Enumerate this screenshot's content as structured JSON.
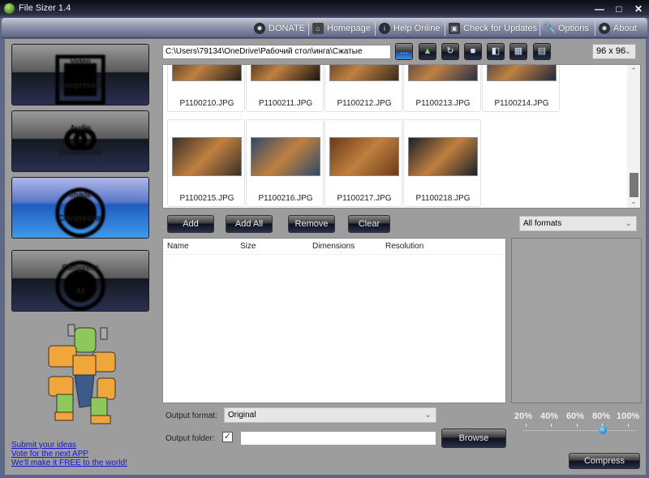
{
  "window": {
    "title": "File Sizer 1.4",
    "controls": [
      "minimize",
      "maximize",
      "close"
    ]
  },
  "toolbar": {
    "items": [
      {
        "label": "DONATE",
        "icon": "donate-icon"
      },
      {
        "label": "Homepage",
        "icon": "home-icon"
      },
      {
        "label": "Help Online",
        "icon": "info-icon"
      },
      {
        "label": "Check for Updates",
        "icon": "updates-icon"
      },
      {
        "label": "Options",
        "icon": "wrench-icon"
      },
      {
        "label": "About",
        "icon": "about-icon"
      }
    ]
  },
  "sidebar": {
    "nav": [
      {
        "line1": "Video",
        "line2": "Compressor",
        "active": false,
        "icon": "video-icon"
      },
      {
        "line1": "Audio",
        "line2": "Compressor",
        "active": false,
        "icon": "headphones-icon"
      },
      {
        "line1": "Image",
        "line2": "Compressor",
        "active": true,
        "icon": "camera-icon"
      },
      {
        "line1": "Compress",
        "line2": "All",
        "active": false,
        "icon": "all-media-icon"
      }
    ],
    "links": [
      "Submit your ideas",
      "Vote for the next APP",
      "We'll make it FREE to the world!"
    ]
  },
  "path_bar": {
    "path": "C:\\Users\\79134\\OneDrive\\Рабочий стол\\инга\\Сжатые",
    "browse_label": "...",
    "icon_buttons": [
      "add-folder-icon",
      "refresh-icon",
      "view-single-icon",
      "view-split-icon",
      "view-grid-icon",
      "view-top-icon"
    ],
    "thumb_size": "96 x 96"
  },
  "gallery": {
    "row1": [
      "P1100210.JPG",
      "P1100211.JPG",
      "P1100212.JPG",
      "P1100213.JPG",
      "P1100214.JPG"
    ],
    "row2": [
      "P1100215.JPG",
      "P1100216.JPG",
      "P1100217.JPG",
      "P1100218.JPG"
    ],
    "colors": [
      "#2a2218",
      "#1a1510",
      "#3a2a1c",
      "#2a3048",
      "#202840",
      "#3a3028",
      "#2f4a68",
      "#6a3a18",
      "#1a2028"
    ]
  },
  "actions": {
    "add": "Add",
    "add_all": "Add All",
    "remove": "Remove",
    "clear": "Clear",
    "format_filter": "All formats"
  },
  "file_list": {
    "columns": [
      "Name",
      "Size",
      "Dimensions",
      "Resolution"
    ],
    "rows": []
  },
  "output": {
    "format_label": "Output format:",
    "format_value": "Original",
    "folder_label": "Output folder:",
    "folder_checked": true,
    "folder_value": "",
    "browse": "Browse"
  },
  "quality": {
    "ticks": [
      "20%",
      "40%",
      "60%",
      "80%",
      "100%"
    ],
    "value_percent": 80
  },
  "compress": "Compress"
}
